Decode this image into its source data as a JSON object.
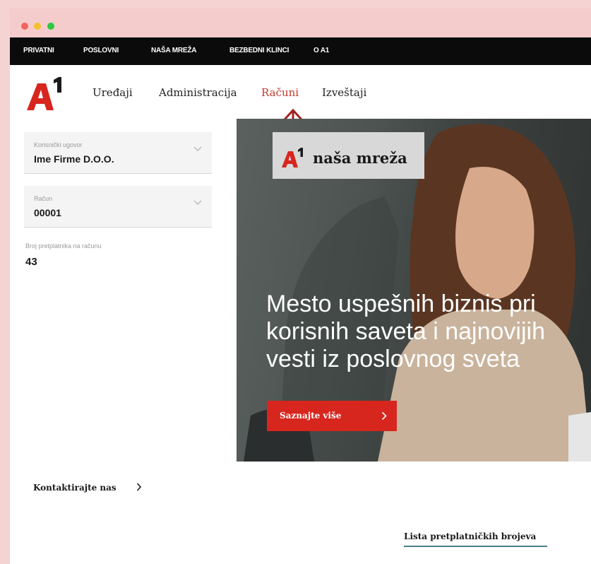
{
  "top_nav": {
    "items": [
      "PRIVATNI",
      "POSLOVNI",
      "NAŠA MREŽA",
      "BEZBEDNI KLINCI",
      "O A1"
    ]
  },
  "logo": {
    "text": "A1",
    "color": "#d7261e"
  },
  "main_nav": {
    "items": [
      "Uređaji",
      "Administracija",
      "Računi",
      "Izveštaji"
    ],
    "active": "Računi"
  },
  "sidebar": {
    "contract": {
      "label": "Korisnički ugovor",
      "value": "Ime Firme D.O.O."
    },
    "account": {
      "label": "Račun",
      "value": "00001"
    },
    "subscribers": {
      "label": "Broj pretplatnika na računu",
      "value": "43"
    }
  },
  "hero": {
    "badge_text": "naša mreža",
    "headline": "Mesto uspešnih biznis pri\nkorisnih saveta i najnovijih\nvesti iz poslovnog sveta",
    "cta_label": "Saznajte više"
  },
  "contact_label": "Kontaktirajte nas",
  "list_title": "Lista pretplatničkih brojeva",
  "colors": {
    "accent": "#d7261e",
    "annotation_arrow": "#a32020",
    "underline": "#4a7f8a"
  }
}
